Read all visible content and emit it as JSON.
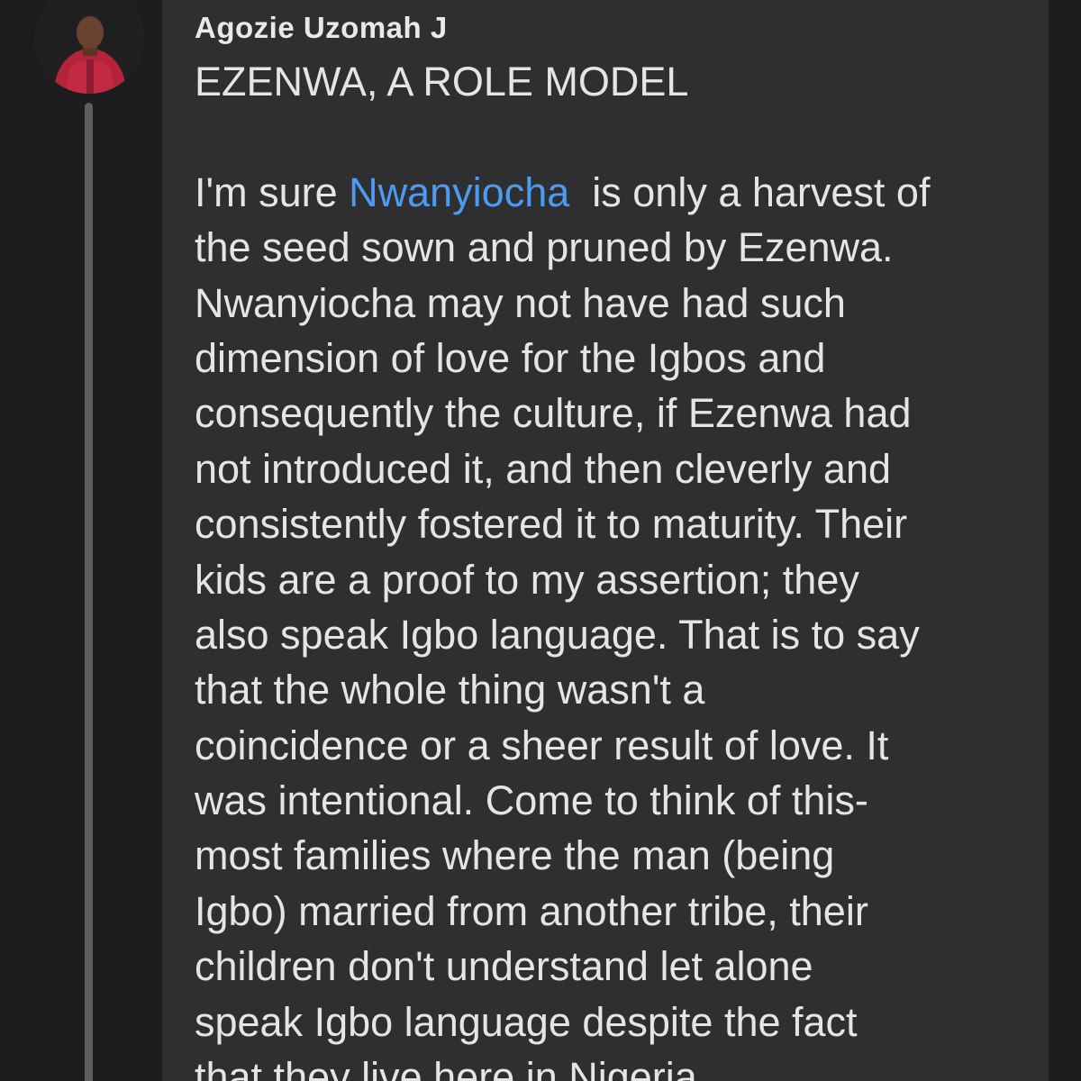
{
  "comment": {
    "author": "Agozie Uzomah J",
    "title": "EZENWA, A ROLE MODEL",
    "mention": "Nwanyiocha",
    "first_line_rest": "  is only a harvest of",
    "first_line_prefix": "I'm sure ",
    "lines": [
      "the seed sown and pruned by Ezenwa.",
      "Nwanyiocha may not have had such",
      "dimension of love for the Igbos and",
      "consequently the culture, if Ezenwa had",
      "not introduced it, and then cleverly and",
      "consistently fostered it to maturity. Their",
      "kids are a proof to my assertion; they",
      "also speak Igbo language. That is to say",
      "that the whole thing wasn't a",
      "coincidence or a sheer result of love. It",
      "was intentional. Come to think of this-",
      "most families where the man (being",
      "Igbo) married from another tribe, their",
      "children don't understand let alone",
      "speak Igbo language despite the fact",
      "that they live here in Nigeria."
    ]
  },
  "colors": {
    "background": "#1d1d1f",
    "bubble": "#2f2f31",
    "text": "#e5e5e7",
    "mention": "#4d9bf0",
    "thread_line": "#5e5e60"
  }
}
